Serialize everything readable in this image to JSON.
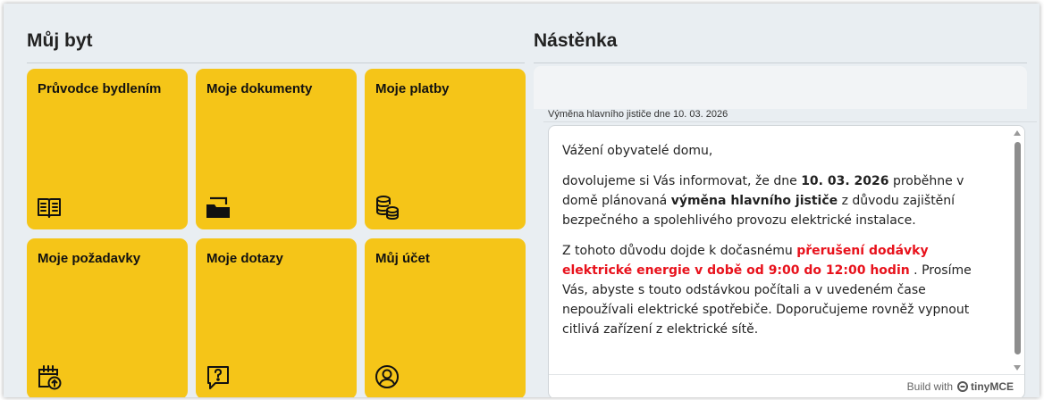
{
  "left_section": {
    "title": "Můj byt",
    "tiles": [
      {
        "label": "Průvodce bydlením",
        "icon": "book-icon"
      },
      {
        "label": "Moje dokumenty",
        "icon": "folder-icon"
      },
      {
        "label": "Moje platby",
        "icon": "coins-icon"
      },
      {
        "label": "Moje požadavky",
        "icon": "calendar-upload-icon"
      },
      {
        "label": "Moje dotazy",
        "icon": "question-bubble-icon"
      },
      {
        "label": "Můj účet",
        "icon": "user-circle-icon"
      }
    ]
  },
  "right_section": {
    "title": "Nástěnka",
    "notice": {
      "title": "Výměna hlavního jističe dne 10. 03. 2026",
      "greeting": "Vážení obyvatelé domu,",
      "p1_before": "dovolujeme si Vás informovat, že dne ",
      "p1_date": "10. 03. 2026",
      "p1_mid": " proběhne v domě plánovaná ",
      "p1_bold": "výměna hlavního jističe",
      "p1_after": " z důvodu zajištění bezpečného a spolehlivého provozu elektrické instalace.",
      "p2_before": "Z tohoto důvodu dojde k dočasnému ",
      "p2_highlight": "přerušení dodávky elektrické energie v době od 9:00 do 12:00 hodin",
      "p2_after": " . Prosíme Vás, abyste s touto odstávkou počítali a v uvedeném čase nepoužívali elektrické spotřebiče. Doporučujeme rovněž vypnout citlivá zařízení z elektrické sítě."
    },
    "editor_footer": {
      "build_with": "Build with",
      "brand": "tinyMCE"
    }
  },
  "colors": {
    "tile_bg": "#f5c518",
    "highlight_red": "#e8121c",
    "page_bg": "#e9eef2"
  }
}
